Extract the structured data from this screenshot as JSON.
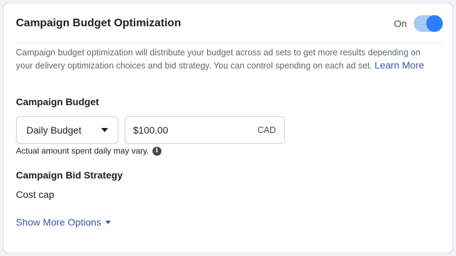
{
  "header": {
    "title": "Campaign Budget Optimization",
    "toggle_label": "On",
    "toggle_state": "on"
  },
  "description": {
    "text": "Campaign budget optimization will distribute your budget across ad sets to get more results depending on your delivery optimization choices and bid strategy. You can control spending on each ad set. ",
    "link": "Learn More"
  },
  "budget": {
    "label": "Campaign Budget",
    "type_selected": "Daily Budget",
    "amount": "$100.00",
    "currency": "CAD",
    "note": "Actual amount spent daily may vary.",
    "info_icon": "info-icon"
  },
  "bid_strategy": {
    "label": "Campaign Bid Strategy",
    "value": "Cost cap"
  },
  "show_more": {
    "label": "Show More Options"
  },
  "colors": {
    "accent": "#2d7ff9",
    "link": "#385898",
    "toggle_track": "#a9c8f5"
  }
}
